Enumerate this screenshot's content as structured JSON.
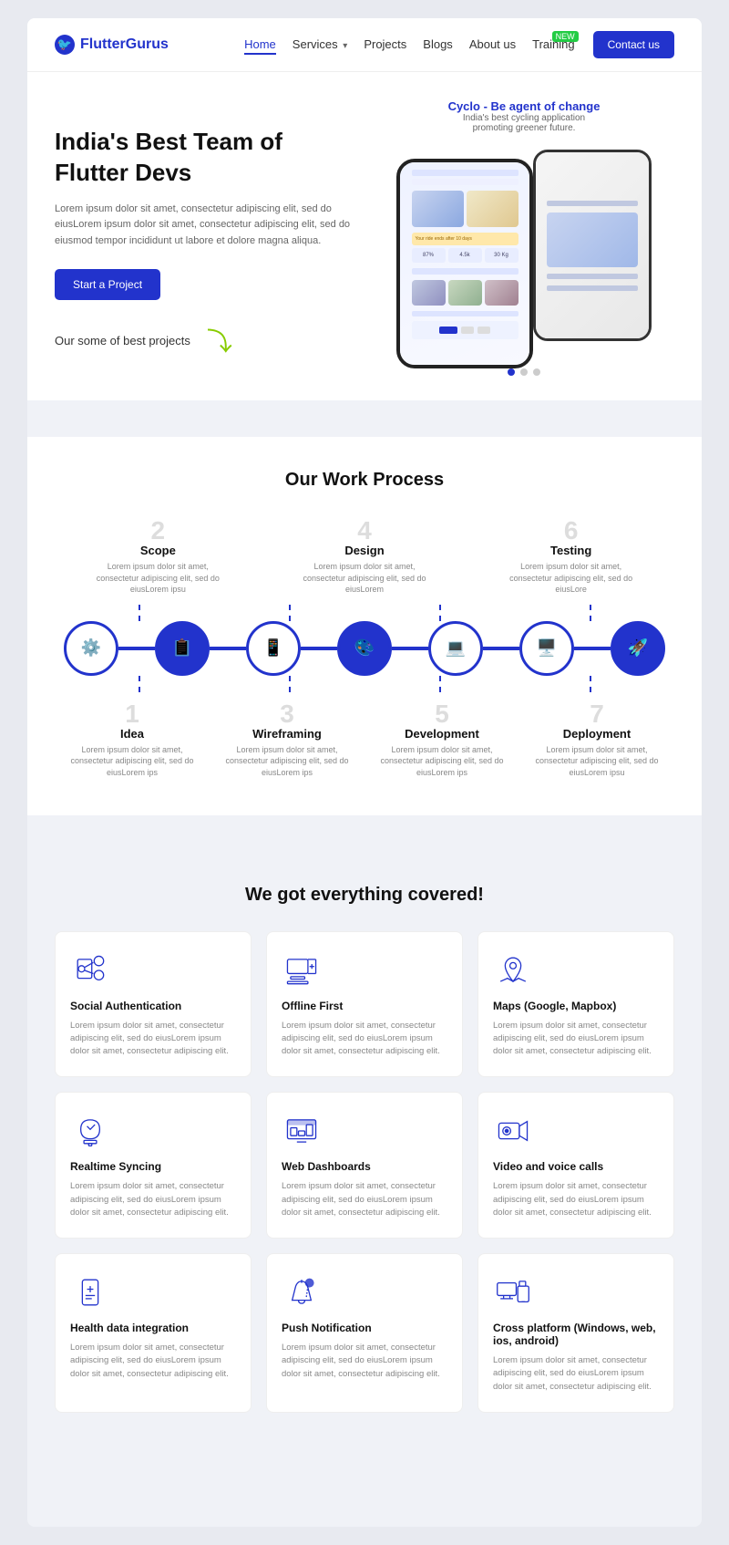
{
  "brand": {
    "name": "FlutterGurus"
  },
  "nav": {
    "links": [
      {
        "label": "Home",
        "active": true
      },
      {
        "label": "Services",
        "dropdown": true
      },
      {
        "label": "Projects"
      },
      {
        "label": "Blogs"
      },
      {
        "label": "About us"
      },
      {
        "label": "Training",
        "badge": "NEW"
      }
    ],
    "contact_btn": "Contact us"
  },
  "hero": {
    "title": "India's Best Team of Flutter Devs",
    "description": "Lorem ipsum dolor sit amet, consectetur adipiscing elit, sed do eiusLorem ipsum dolor sit amet, consectetur adipiscing elit, sed do eiusmod tempor incididunt ut labore et dolore magna aliqua.",
    "cta_btn": "Start a Project",
    "projects_label": "Our some of best projects",
    "app_name": "Cyclo - Be agent of change",
    "app_desc": "India's best cycling application\npromoting greener future.",
    "carousel_dots": [
      true,
      false,
      false
    ]
  },
  "work_process": {
    "title": "Our Work Process",
    "steps_top": [
      {
        "number": "2",
        "name": "Scope",
        "desc": "Lorem ipsum dolor sit amet, consectetur adipiscing elit, sed do eiusLorem ipsu"
      },
      {
        "number": "4",
        "name": "Design",
        "desc": "Lorem ipsum dolor sit amet, consectetur adipiscing elit, sed do eiusLorem"
      },
      {
        "number": "6",
        "name": "Testing",
        "desc": "Lorem ipsum dolor sit amet, consectetur adipiscing elit, sed do eiusLore"
      }
    ],
    "steps_bottom": [
      {
        "number": "1",
        "name": "Idea",
        "desc": "Lorem ipsum dolor sit amet, consectetur adipiscing elit, sed do eiusLorem ips"
      },
      {
        "number": "3",
        "name": "Wireframing",
        "desc": "Lorem ipsum dolor sit amet, consectetur adipiscing elit, sed do eiusLorem ips"
      },
      {
        "number": "5",
        "name": "Development",
        "desc": "Lorem ipsum dolor sit amet, consectetur adipiscing elit, sed do eiusLorem ips"
      },
      {
        "number": "7",
        "name": "Deployment",
        "desc": "Lorem ipsum dolor sit amet, consectetur adipiscing elit, sed do eiusLorem ipsu"
      }
    ],
    "timeline_icons": [
      "⚙️",
      "📋",
      "📱",
      "🎨",
      "💻",
      "🚀"
    ]
  },
  "covered": {
    "title": "We got everything covered!",
    "features": [
      {
        "name": "Social Authentication",
        "desc": "Lorem ipsum dolor sit amet, consectetur adipiscing elit, sed do eiusLorem ipsum dolor sit amet, consectetur adipiscing elit.",
        "icon": "social-auth"
      },
      {
        "name": "Offline First",
        "desc": "Lorem ipsum dolor sit amet, consectetur adipiscing elit, sed do eiusLorem ipsum dolor sit amet, consectetur adipiscing elit.",
        "icon": "offline"
      },
      {
        "name": "Maps (Google, Mapbox)",
        "desc": "Lorem ipsum dolor sit amet, consectetur adipiscing elit, sed do eiusLorem ipsum dolor sit amet, consectetur adipiscing elit.",
        "icon": "maps"
      },
      {
        "name": "Realtime Syncing",
        "desc": "Lorem ipsum dolor sit amet, consectetur adipiscing elit, sed do eiusLorem ipsum dolor sit amet, consectetur adipiscing elit.",
        "icon": "realtime"
      },
      {
        "name": "Web Dashboards",
        "desc": "Lorem ipsum dolor sit amet, consectetur adipiscing elit, sed do eiusLorem ipsum dolor sit amet, consectetur adipiscing elit.",
        "icon": "dashboard"
      },
      {
        "name": "Video and voice calls",
        "desc": "Lorem ipsum dolor sit amet, consectetur adipiscing elit, sed do eiusLorem ipsum dolor sit amet, consectetur adipiscing elit.",
        "icon": "video"
      },
      {
        "name": "Health data integration",
        "desc": "Lorem ipsum dolor sit amet, consectetur adipiscing elit, sed do eiusLorem ipsum dolor sit amet, consectetur adipiscing elit.",
        "icon": "health"
      },
      {
        "name": "Push Notification",
        "desc": "Lorem ipsum dolor sit amet, consectetur adipiscing elit, sed do eiusLorem ipsum dolor sit amet, consectetur adipiscing elit.",
        "icon": "push"
      },
      {
        "name": "Cross platform (Windows, web, ios, android)",
        "desc": "Lorem ipsum dolor sit amet, consectetur adipiscing elit, sed do eiusLorem ipsum dolor sit amet, consectetur adipiscing elit.",
        "icon": "crossplatform"
      }
    ]
  }
}
